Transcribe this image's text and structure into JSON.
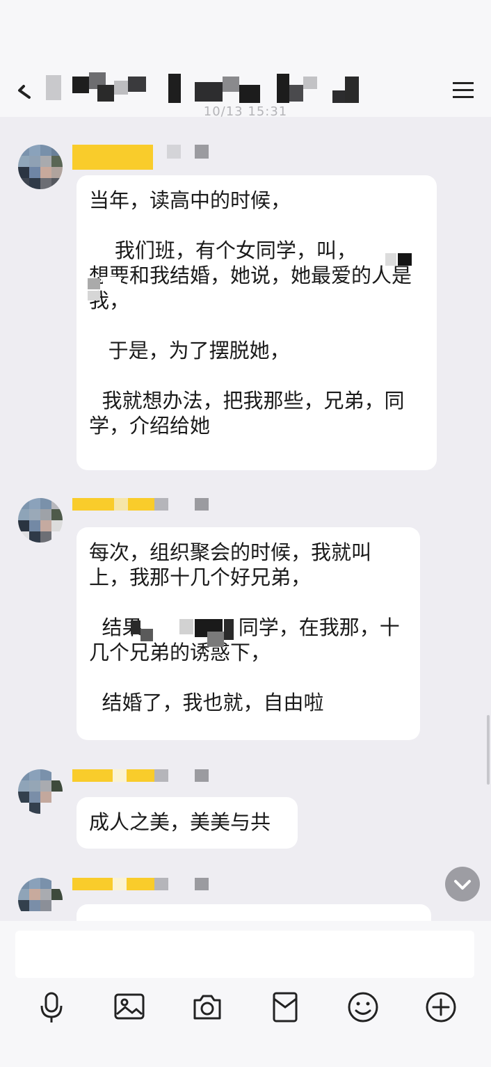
{
  "header": {
    "back_icon": "back-arrow-icon",
    "menu_icon": "hamburger-menu-icon",
    "timestamp": "10/13 15:31"
  },
  "messages": [
    {
      "paragraphs": [
        "当年，读高中的时候，",
        "    我们班，有个女同学，叫，        想要和我结婚，她说，她最爱的人是我，",
        "   于是，为了摆脱她，",
        "  我就想办法，把我那些，兄弟，同学，介绍给她"
      ]
    },
    {
      "paragraphs": [
        "每次，组织聚会的时候，我就叫上，我那十几个好兄弟，",
        "  结果               同学，在我那，十几个兄弟的诱惑下，",
        "  结婚了，我也就，自由啦"
      ]
    },
    {
      "paragraphs": [
        "成人之美，美美与共"
      ]
    }
  ],
  "toolbar": {
    "items": [
      {
        "icon": "microphone-icon"
      },
      {
        "icon": "image-icon"
      },
      {
        "icon": "camera-icon"
      },
      {
        "icon": "red-packet-icon"
      },
      {
        "icon": "emoji-icon"
      },
      {
        "icon": "plus-icon"
      }
    ]
  },
  "colors": {
    "chat_bg": "#eeedf2",
    "bubble": "#ffffff",
    "nickname_highlight": "#f9cc2b"
  }
}
